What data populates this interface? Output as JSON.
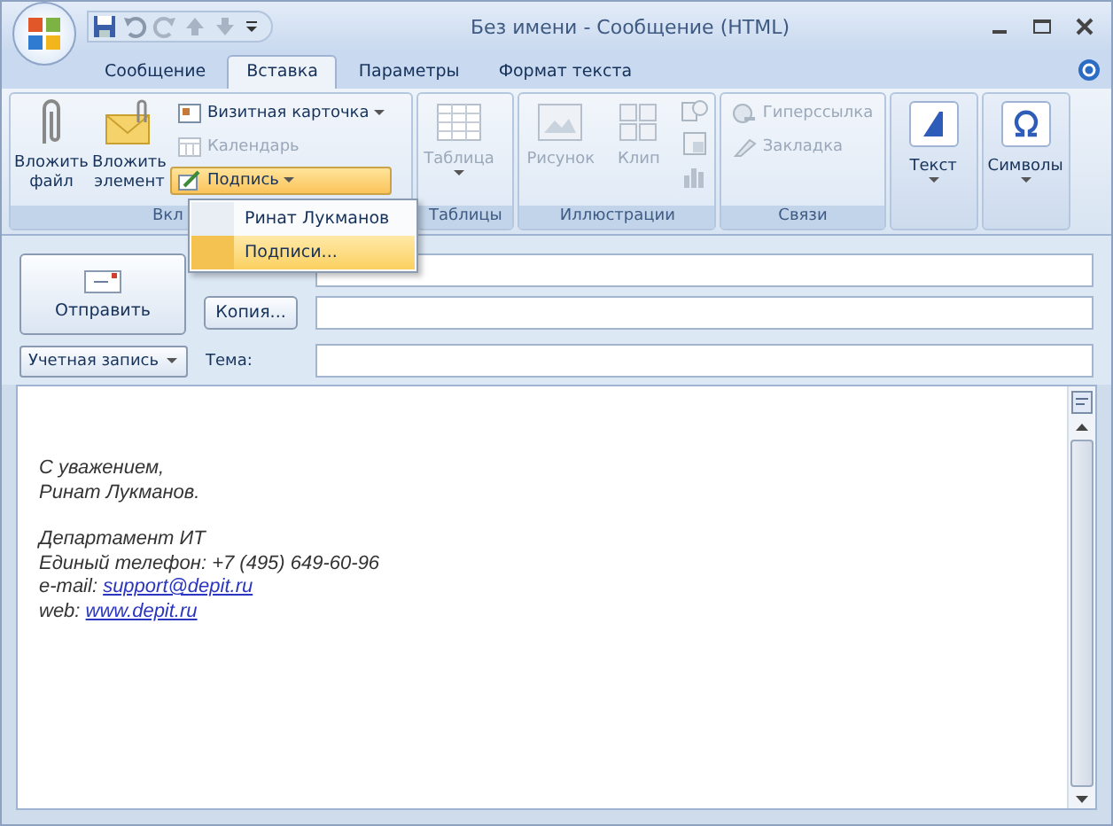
{
  "window": {
    "title": "Без имени - Сообщение (HTML)"
  },
  "tabs": [
    {
      "label": "Сообщение",
      "selected": false
    },
    {
      "label": "Вставка",
      "selected": true
    },
    {
      "label": "Параметры",
      "selected": false
    },
    {
      "label": "Формат текста",
      "selected": false
    }
  ],
  "ribbon": {
    "groups": [
      {
        "label": "Вкл",
        "items": [
          {
            "kind": "large",
            "label": "Вложить файл",
            "disabled": false,
            "dropdown": false
          },
          {
            "kind": "large",
            "label": "Вложить элемент",
            "disabled": false,
            "dropdown": false
          },
          {
            "kind": "small",
            "label": "Визитная карточка",
            "disabled": false,
            "dropdown": true,
            "pressed": false
          },
          {
            "kind": "small",
            "label": "Календарь",
            "disabled": true,
            "dropdown": false,
            "pressed": false
          },
          {
            "kind": "small",
            "label": "Подпись",
            "disabled": false,
            "dropdown": true,
            "pressed": true
          }
        ]
      },
      {
        "label": "Таблицы",
        "items": [
          {
            "kind": "large",
            "label": "Таблица",
            "disabled": true,
            "dropdown": true
          }
        ]
      },
      {
        "label": "Иллюстрации",
        "items": [
          {
            "kind": "large",
            "label": "Рисунок",
            "disabled": true,
            "dropdown": false
          },
          {
            "kind": "large",
            "label": "Клип",
            "disabled": true,
            "dropdown": false
          },
          {
            "kind": "iconcol",
            "disabled": true
          }
        ]
      },
      {
        "label": "Связи",
        "items": [
          {
            "kind": "small",
            "label": "Гиперссылка",
            "disabled": true,
            "dropdown": false,
            "pressed": false
          },
          {
            "kind": "small",
            "label": "Закладка",
            "disabled": true,
            "dropdown": false,
            "pressed": false
          }
        ]
      },
      {
        "items": [
          {
            "kind": "large",
            "label": "Текст",
            "disabled": false,
            "dropdown": true
          }
        ]
      },
      {
        "items": [
          {
            "kind": "large",
            "label": "Символы",
            "disabled": false,
            "dropdown": true
          }
        ]
      }
    ]
  },
  "menu": {
    "items": [
      {
        "label": "Ринат Лукманов",
        "selected": false
      },
      {
        "label": "Подписи...",
        "selected": true
      }
    ]
  },
  "form": {
    "send_button": "Отправить",
    "cc_button": "Копия...",
    "account_button": "Учетная запись",
    "subject_label": "Тема:"
  },
  "body": {
    "paragraphs": [
      {
        "lines": [
          {
            "kind": "text",
            "text": "С уважением,"
          },
          {
            "kind": "text",
            "text": "Ринат Лукманов."
          }
        ]
      },
      {
        "lines": [
          {
            "kind": "text",
            "text": "Департамент ИТ"
          },
          {
            "kind": "text",
            "text": "Единый телефон: +7 (495) 649-60-96"
          },
          {
            "kind": "link",
            "prefix": "e-mail:",
            "link": "support@depit.ru"
          },
          {
            "kind": "link",
            "prefix": "web:",
            "link": "www.depit.ru"
          }
        ]
      }
    ]
  }
}
